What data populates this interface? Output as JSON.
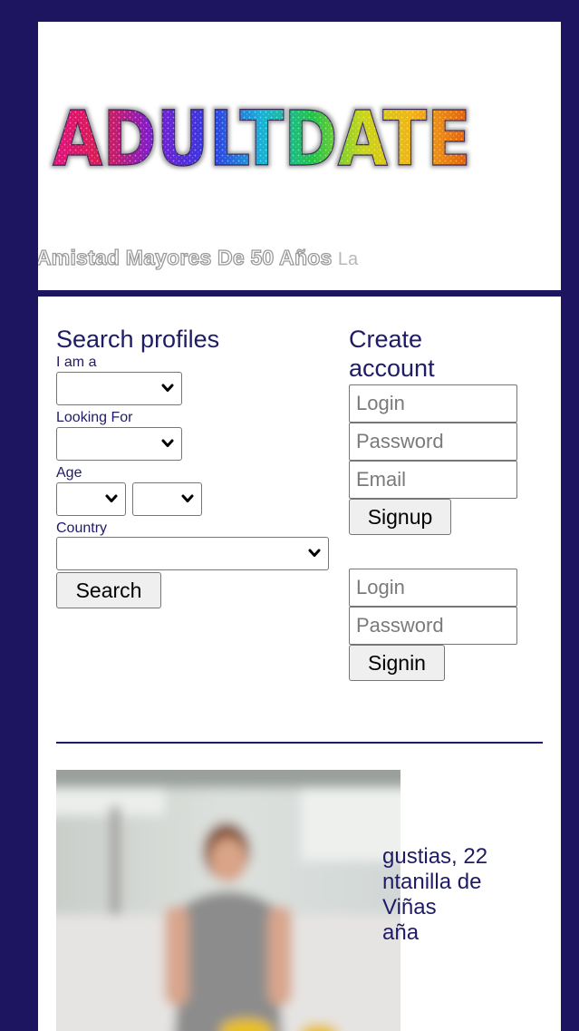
{
  "header": {
    "logo_text": "ADULTDATE",
    "tagline_main": "Amistad Mayores De 50 Años",
    "tagline_suffix": "La"
  },
  "search": {
    "title": "Search profiles",
    "i_am_label": "I am a",
    "looking_for_label": "Looking For",
    "age_label": "Age",
    "country_label": "Country",
    "i_am_value": "",
    "looking_for_value": "",
    "age_from_value": "",
    "age_to_value": "",
    "country_value": "",
    "search_button": "Search"
  },
  "account": {
    "title_line1": "Create",
    "title_line2": "account",
    "signup_login_placeholder": "Login",
    "signup_password_placeholder": "Password",
    "signup_email_placeholder": "Email",
    "signup_button": "Signup",
    "signin_login_placeholder": "Login",
    "signin_password_placeholder": "Password",
    "signin_button": "Signin"
  },
  "profile": {
    "lines": [
      "gustias, 22",
      "ntanilla de",
      "Viñas",
      "aña"
    ]
  },
  "colors": {
    "frame": "#1d1560",
    "text_accent": "#1f1b66"
  },
  "icons": {
    "select_arrow": "chevron-down-icon"
  }
}
